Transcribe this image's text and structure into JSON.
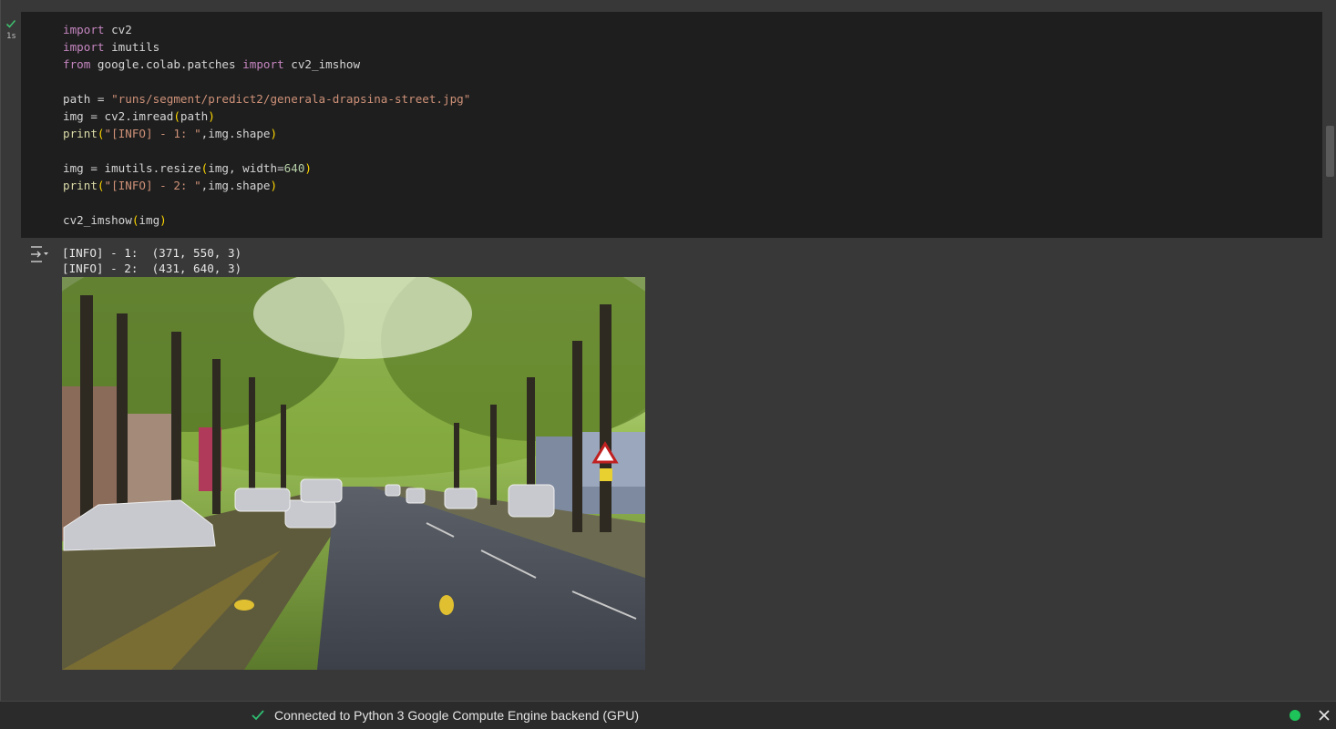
{
  "cell": {
    "exec_time": "1s",
    "code_lines": [
      [
        {
          "t": "import",
          "c": "kw"
        },
        {
          "t": " cv2"
        }
      ],
      [
        {
          "t": "import",
          "c": "kw"
        },
        {
          "t": " imutils"
        }
      ],
      [
        {
          "t": "from",
          "c": "kw"
        },
        {
          "t": " google.colab.patches "
        },
        {
          "t": "import",
          "c": "kw"
        },
        {
          "t": " cv2_imshow"
        }
      ],
      [],
      [
        {
          "t": "path = "
        },
        {
          "t": "\"runs/segment/predict2/generala-drapsina-street.jpg\"",
          "c": "str"
        }
      ],
      [
        {
          "t": "img = cv2.imread"
        },
        {
          "t": "(",
          "c": "par"
        },
        {
          "t": "path"
        },
        {
          "t": ")",
          "c": "par"
        }
      ],
      [
        {
          "t": "print",
          "c": "fn"
        },
        {
          "t": "(",
          "c": "par"
        },
        {
          "t": "\"[INFO] - 1: \"",
          "c": "str"
        },
        {
          "t": ",img.shape"
        },
        {
          "t": ")",
          "c": "par"
        }
      ],
      [],
      [
        {
          "t": "img = imutils.resize"
        },
        {
          "t": "(",
          "c": "par"
        },
        {
          "t": "img, width="
        },
        {
          "t": "640",
          "c": "num"
        },
        {
          "t": ")",
          "c": "par"
        }
      ],
      [
        {
          "t": "print",
          "c": "fn"
        },
        {
          "t": "(",
          "c": "par"
        },
        {
          "t": "\"[INFO] - 2: \"",
          "c": "str"
        },
        {
          "t": ",img.shape"
        },
        {
          "t": ")",
          "c": "par"
        }
      ],
      [],
      [
        {
          "t": "cv2_imshow"
        },
        {
          "t": "(",
          "c": "par"
        },
        {
          "t": "img"
        },
        {
          "t": ")",
          "c": "par"
        }
      ]
    ]
  },
  "output": {
    "lines": [
      "[INFO] - 1:  (371, 550, 3)",
      "[INFO] - 2:  (431, 640, 3)"
    ]
  },
  "statusbar": {
    "text": "Connected to Python 3 Google Compute Engine backend (GPU)",
    "dot_color": "#1ec45a",
    "check_color": "#2fbf71"
  },
  "colors": {
    "code_bg": "#1e1e1e",
    "cell_bg": "#383838",
    "keyword": "#c586c0",
    "string": "#ce9178"
  },
  "icons": {
    "run": "play-circle-icon",
    "output_menu": "output-actions-icon",
    "close": "close-icon",
    "exec_status": "check-icon"
  }
}
